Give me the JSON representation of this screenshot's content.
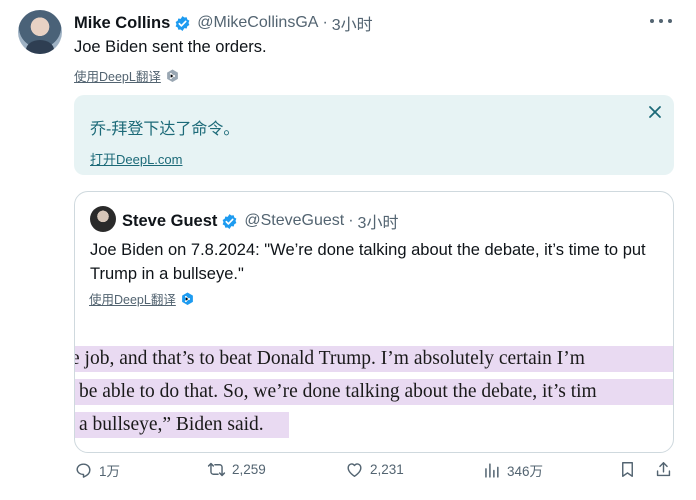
{
  "tweet": {
    "author_name": "Mike Collins",
    "handle": "@MikeCollinsGA",
    "separator": "·",
    "time": "3小时",
    "text": "Joe Biden sent the orders.",
    "translate_link": "使用DeepL翻译"
  },
  "translation": {
    "text": "乔-拜登下达了命令。",
    "open_link": "打开DeepL.com"
  },
  "quote": {
    "author_name": "Steve Guest",
    "handle": "@SteveGuest",
    "separator": "·",
    "time": "3小时",
    "text": "Joe Biden on 7.8.2024: \"We’re done talking about the debate, it’s time to put Trump in a bullseye.\"",
    "translate_link": "使用DeepL翻译",
    "article_lines": [
      "e job, and that’s to beat Donald Trump. I’m absolutely certain I’m",
      "be able to do that. So, we’re done talking about the debate, it’s tim",
      "a bullseye,” Biden said."
    ]
  },
  "actions": {
    "replies": "1万",
    "retweets": "2,259",
    "likes": "2,231",
    "views": "346万"
  },
  "colors": {
    "verified": "#1d9bf0",
    "translate_bg": "#e7f3f4",
    "translate_text": "#1c6a78",
    "highlight": "#e9daf2"
  }
}
